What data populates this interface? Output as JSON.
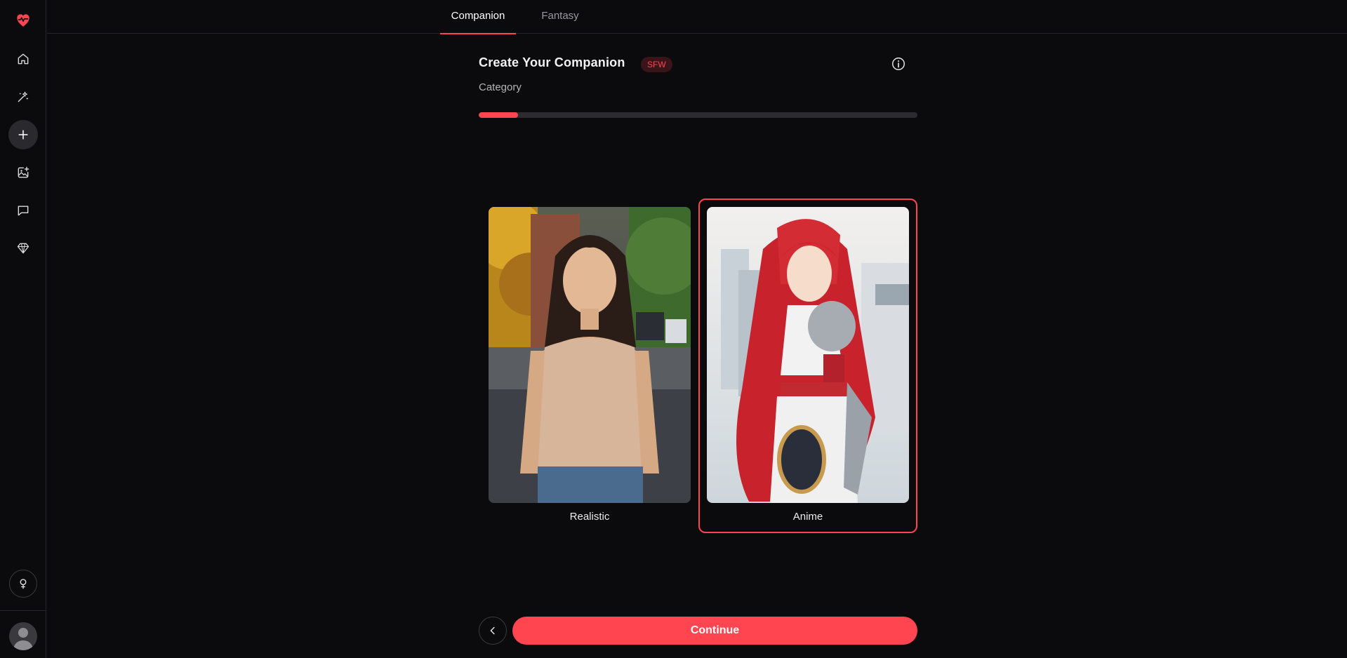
{
  "accent_color": "#ff4550",
  "sidebar": {
    "logo_icon": "heart-pulse-icon",
    "items": [
      {
        "icon": "home-icon",
        "label": "Home"
      },
      {
        "icon": "sparkles-icon",
        "label": "Explore"
      },
      {
        "icon": "plus-icon",
        "label": "Create"
      },
      {
        "icon": "image-plus-icon",
        "label": "Generate Image"
      },
      {
        "icon": "chat-icon",
        "label": "Chat"
      },
      {
        "icon": "diamond-icon",
        "label": "Premium"
      }
    ],
    "gender_icon": "female-symbol-icon",
    "avatar_icon": "user-avatar-icon"
  },
  "tabs": [
    {
      "label": "Companion",
      "active": true
    },
    {
      "label": "Fantasy",
      "active": false
    }
  ],
  "header": {
    "title": "Create Your Companion",
    "badge": "SFW",
    "info_icon": "info-icon"
  },
  "step": {
    "label": "Category",
    "progress_fraction": 0.09
  },
  "options": [
    {
      "label": "Realistic",
      "selected": false,
      "image": "realistic-woman-photo"
    },
    {
      "label": "Anime",
      "selected": true,
      "image": "anime-red-hair-knight"
    }
  ],
  "actions": {
    "back_icon": "chevron-left-icon",
    "continue_label": "Continue"
  }
}
